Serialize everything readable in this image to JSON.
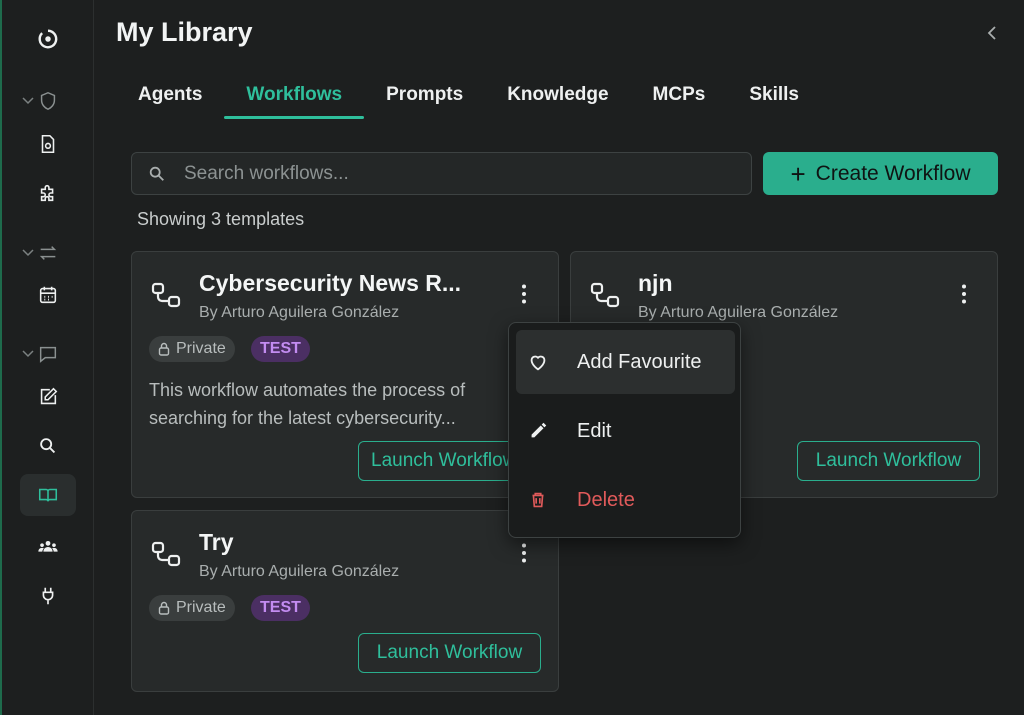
{
  "header": {
    "title": "My Library"
  },
  "tabs": [
    {
      "label": "Agents"
    },
    {
      "label": "Workflows"
    },
    {
      "label": "Prompts"
    },
    {
      "label": "Knowledge"
    },
    {
      "label": "MCPs"
    },
    {
      "label": "Skills"
    }
  ],
  "active_tab": "Workflows",
  "search": {
    "placeholder": "Search workflows..."
  },
  "create_button": {
    "label": "Create Workflow"
  },
  "count_text": "Showing 3 templates",
  "cards": [
    {
      "title": "Cybersecurity News R...",
      "author": "By Arturo Aguilera González",
      "visibility": "Private",
      "tag": "TEST",
      "description_lines": [
        "This workflow automates the process of",
        "searching for the latest cybersecurity..."
      ],
      "launch_label": "Launch Workflow"
    },
    {
      "title": "njn",
      "author": "By Arturo Aguilera González",
      "launch_label": "Launch Workflow"
    },
    {
      "title": "Try",
      "author": "By Arturo Aguilera González",
      "visibility": "Private",
      "tag": "TEST",
      "launch_label": "Launch Workflow"
    }
  ],
  "context_menu": {
    "items": [
      {
        "label": "Add Favourite",
        "icon": "heart-icon"
      },
      {
        "label": "Edit",
        "icon": "pencil-icon"
      },
      {
        "label": "Delete",
        "icon": "trash-icon"
      }
    ]
  },
  "sidebar": {
    "icons": [
      "logo-icon",
      "shield-icon",
      "document-icon",
      "puzzle-icon",
      "transfer-icon",
      "calendar-icon",
      "chat-icon",
      "edit-icon",
      "search-icon",
      "library-icon",
      "team-icon",
      "plug-icon"
    ]
  },
  "colors": {
    "accent": "#2aae8d",
    "background": "#1d1f1f",
    "card": "#272a2a",
    "tag_purple": "#c38cf1",
    "danger": "#e05a5a"
  }
}
